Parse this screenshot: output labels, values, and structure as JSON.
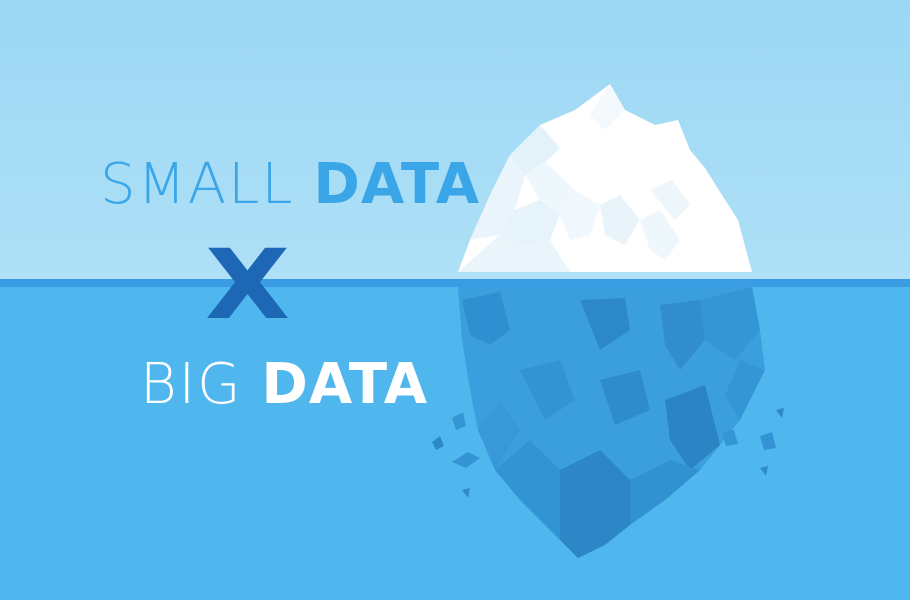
{
  "headline": {
    "line1_light": "SMALL",
    "line1_bold": "DATA",
    "separator": "X",
    "line2_light": "BIG",
    "line2_bold": "DATA"
  },
  "colors": {
    "sky": "#a3dbf5",
    "sea": "#4fb7ee",
    "waterline": "#3a9de3",
    "small_data_text": "#3aa6e8",
    "x_mark": "#1d67b5",
    "big_data_text": "#ffffff",
    "ice_white": "#ffffff",
    "ice_shade": "#e8f4fb",
    "ice_under": "#3b9fdd",
    "ice_under_dark": "#2c86c5"
  },
  "illustration": "iceberg-icon"
}
